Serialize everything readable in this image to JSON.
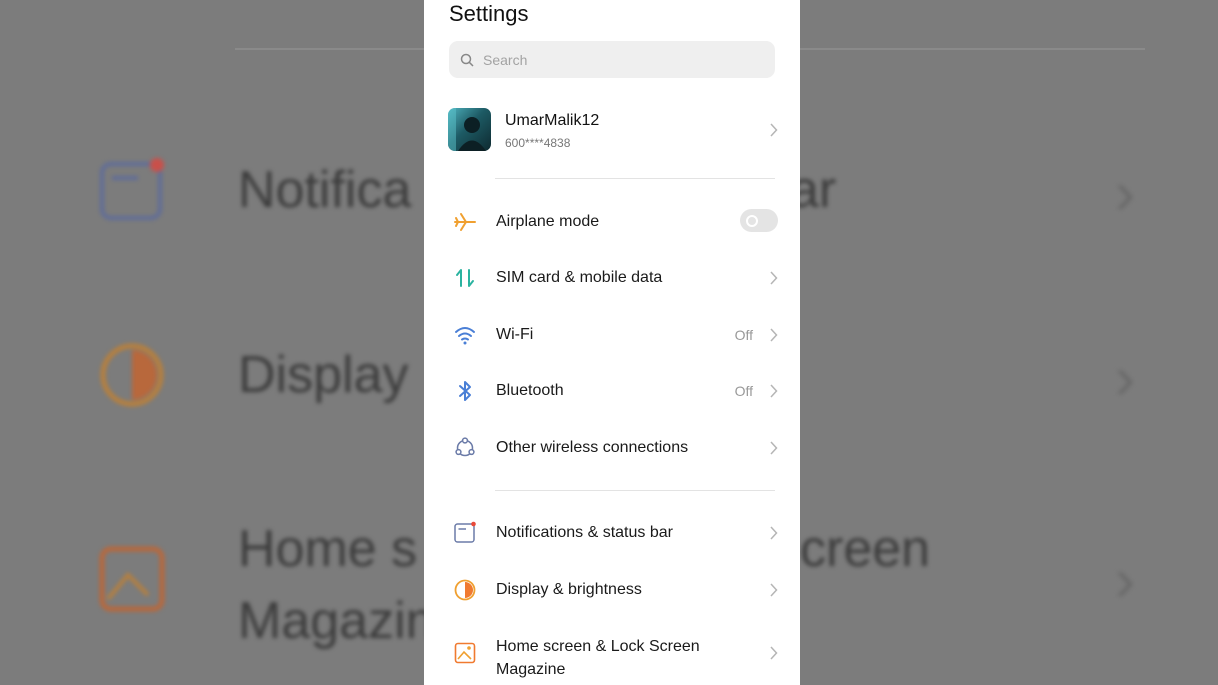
{
  "background": {
    "rows": [
      "Notifica",
      "ar",
      "Display",
      "Home s",
      "creen",
      "Magazin"
    ]
  },
  "settings": {
    "title": "Settings",
    "search_placeholder": "Search",
    "account": {
      "name": "UmarMalik12",
      "number": "600****4838"
    },
    "items": [
      {
        "label": "Airplane mode",
        "icon": "airplane-icon",
        "control": "toggle",
        "state": "off"
      },
      {
        "label": "SIM card & mobile data",
        "icon": "sim-data-icon"
      },
      {
        "label": "Wi-Fi",
        "icon": "wifi-icon",
        "value": "Off"
      },
      {
        "label": "Bluetooth",
        "icon": "bluetooth-icon",
        "value": "Off"
      },
      {
        "label": "Other wireless connections",
        "icon": "wireless-connections-icon"
      },
      {
        "label": "Notifications & status bar",
        "icon": "notifications-icon"
      },
      {
        "label": "Display & brightness",
        "icon": "display-brightness-icon"
      },
      {
        "label": "Home screen & Lock Screen Magazine",
        "icon": "home-screen-icon"
      }
    ]
  },
  "colors": {
    "airplane": "#f0a030",
    "sim": "#2bb3a0",
    "wifi": "#4a7fd6",
    "bluetooth": "#4a7fd6",
    "display": "#f07a30",
    "notification_dot": "#e94a3a"
  }
}
